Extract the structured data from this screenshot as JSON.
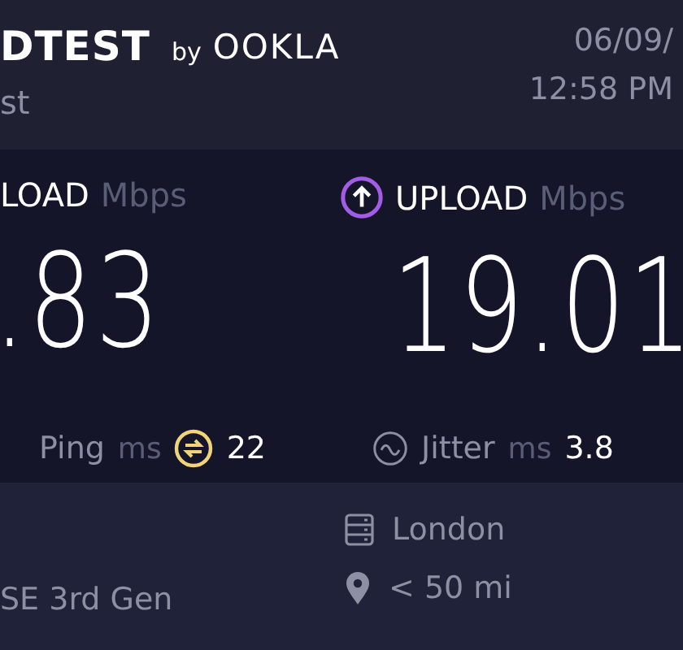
{
  "header": {
    "brand": "DTEST",
    "brand_by": "by",
    "brand_company": "OOKLA",
    "subtitle": "st",
    "date": "06/09/",
    "time": "12:58 PM"
  },
  "results": [
    {
      "kind": "download",
      "label": "LOAD",
      "unit": "Mbps",
      "value": ".83"
    },
    {
      "kind": "upload",
      "label": "UPLOAD",
      "unit": "Mbps",
      "value": "19.01"
    }
  ],
  "metrics": [
    {
      "kind": "ping",
      "label": "Ping",
      "unit": "ms",
      "value": "22"
    },
    {
      "kind": "jitter",
      "label": "Jitter",
      "unit": "ms",
      "value": "3.8"
    }
  ],
  "device": {
    "name": "SE 3rd Gen"
  },
  "server": [
    {
      "kind": "server",
      "text": "London"
    },
    {
      "kind": "distance",
      "text": "< 50 mi"
    }
  ]
}
